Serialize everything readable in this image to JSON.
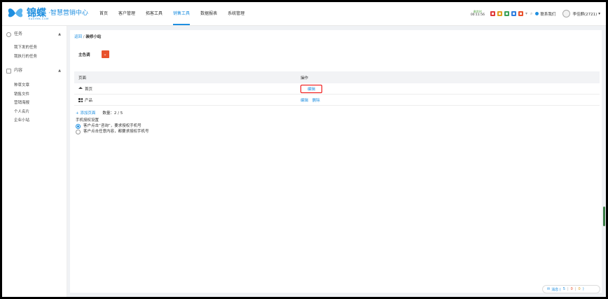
{
  "header": {
    "logo_text": "锦蝶",
    "logo_sub": "·智慧营销中心",
    "logo_en": "EASYMK.COM",
    "nav": [
      {
        "label": "首页",
        "active": false
      },
      {
        "label": "客户管理",
        "active": false
      },
      {
        "label": "拓客工具",
        "active": false
      },
      {
        "label": "销售工具",
        "active": true
      },
      {
        "label": "数据报表",
        "active": false
      },
      {
        "label": "系统管理",
        "active": false
      }
    ],
    "clock_label": "剩余时",
    "clock_time": "00:11:56",
    "contact_label": "联系我们",
    "user_label": "李佳麒(2721)"
  },
  "sidebar": {
    "group1": {
      "label": "任务",
      "items": [
        "我下发的任务",
        "我执行的任务"
      ]
    },
    "group2": {
      "label": "内容",
      "items": [
        "种草文章",
        "销售文件",
        "营销海报",
        "个人名片",
        "企业小站"
      ]
    }
  },
  "main": {
    "breadcrumb": {
      "link": "返回",
      "sep": "/",
      "current": "装修小站"
    },
    "theme_label": "主色调",
    "theme_color": "#e8512c",
    "table": {
      "headers": [
        "页面",
        "操作"
      ],
      "rows": [
        {
          "name": "首页",
          "icon": "home-icon",
          "ops": [
            "编辑"
          ]
        },
        {
          "name": "产品",
          "icon": "grid-icon",
          "ops": [
            "编辑",
            "删除"
          ]
        }
      ]
    },
    "add_page": "+ 添加页面",
    "count": "数量：2 / 5",
    "auth_title": "手机授权设置",
    "auth_options": [
      {
        "label": "客户点击“咨询”，要求授权手机号",
        "selected": true
      },
      {
        "label": "客户点击任意内容，都要求授权手机号",
        "selected": false
      }
    ]
  },
  "messages": {
    "label": "消息 (",
    "n1": "5",
    "n2": "0",
    "n3": "0",
    "close": ")"
  }
}
